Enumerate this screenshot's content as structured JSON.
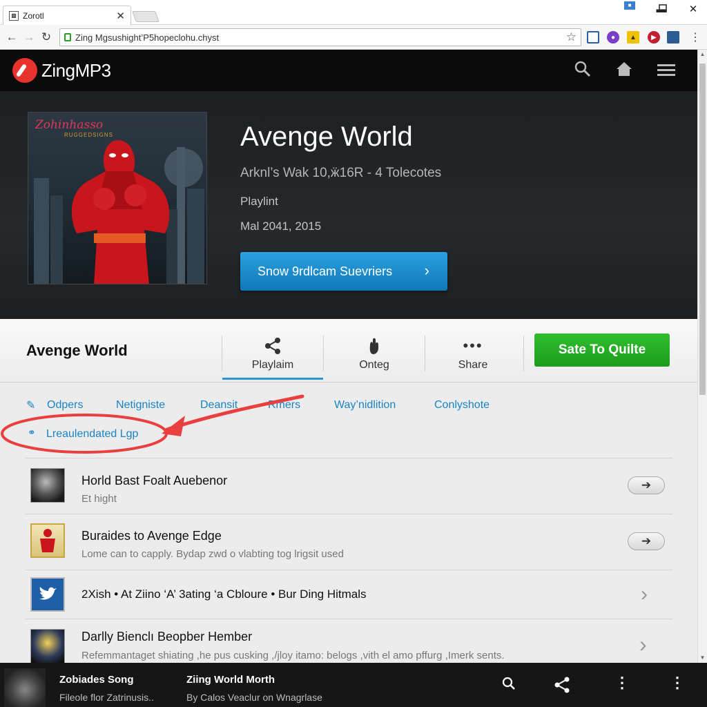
{
  "browser": {
    "tab_title": "Zorotl",
    "tab_favicon": "page-icon",
    "url": "Zing Mgsushight’P5hopeclohu.chyst",
    "window_controls": [
      "minimize",
      "maximize",
      "close"
    ]
  },
  "site": {
    "brand": "ZingMP3",
    "accent": "#e8332d",
    "header_icons": [
      "search-icon",
      "home-icon",
      "menu-icon"
    ]
  },
  "hero": {
    "cover_text": "Zohinhasso",
    "cover_subtext": "RUGGEDSIGNS",
    "title": "Avenge World",
    "meta": "Arknl’s Wak 10,ӝ16R  - 4 Tolecotes",
    "type": "Playlint",
    "date": "Mal 2041, 2015",
    "cta": "Snow 9rdlcam Suevriers",
    "cta_color": "#1a8fd1"
  },
  "actions": {
    "title": "Avenge World",
    "items": [
      {
        "label": "Playlaim",
        "icon": "share-icon",
        "active": true
      },
      {
        "label": "Onteg",
        "icon": "hand-icon",
        "active": false
      },
      {
        "label": "Share",
        "icon": "more-icon",
        "active": false
      }
    ],
    "save": "Sate To Quilte",
    "save_color": "#22a722"
  },
  "links": [
    "Odpers",
    "Netigniste",
    "Deansit",
    "Rmers",
    "Way’nidlition",
    "Conlyshote"
  ],
  "highlighted_link": "Lreaulendated Lgp",
  "rows": [
    {
      "title": "Horld Bast Foalt Auebenor",
      "subtitle": "Et hight",
      "action": "➔"
    },
    {
      "title": "Buraides to Avenge Edge",
      "subtitle": "Lome can to capply. Bydap zwd o vlabting tog lrigsit used",
      "action": "➔"
    },
    {
      "links": "2Xish  • At Ziino ‘A’ 3ating ‘a Cbloure  • Bur Ding Hitmals",
      "action": "›"
    },
    {
      "title": "Darlly Bienclı Beopber Hember",
      "subtitle": "Refemmantaget shiating ,he pus cusking ,/jloy itamo: belogs ,vith el amo pffurg ,Imerk sents.",
      "action": "›"
    }
  ],
  "player": {
    "track1_title": "Zobiades Song",
    "track1_sub": "Fileole flor Zatrinusis..",
    "track2_title": "Ziing World Morth",
    "track2_sub": "By Calos Veaclur on Wnagrlase",
    "icons": [
      "search-icon",
      "share-icon",
      "more-vertical-icon",
      "more-vertical-icon"
    ]
  }
}
